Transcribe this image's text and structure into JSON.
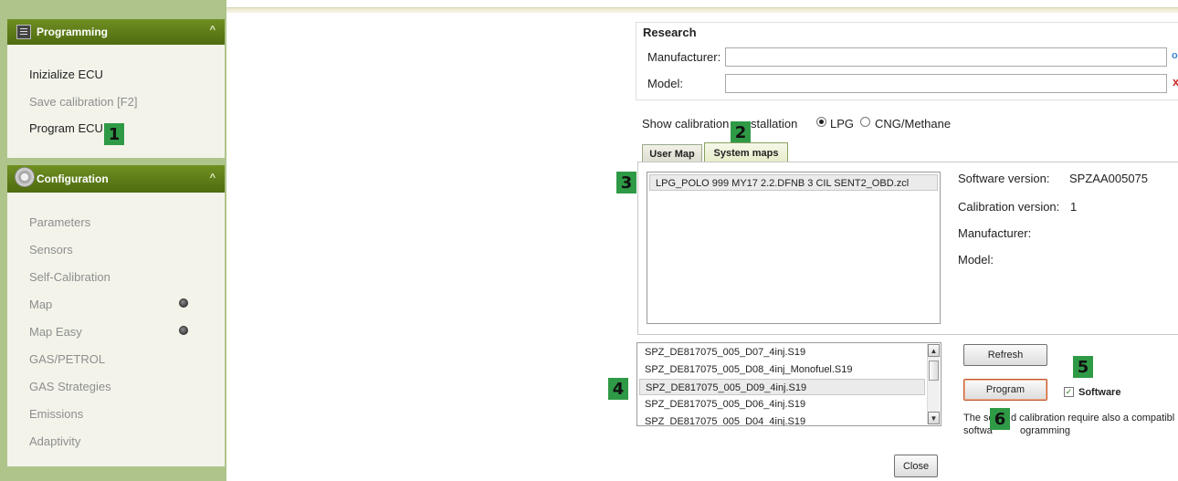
{
  "sidebar": {
    "programming": {
      "title": "Programming",
      "items": [
        {
          "label": "Inizialize ECU"
        },
        {
          "label": "Save calibration [F2]"
        },
        {
          "label": "Program ECU"
        }
      ]
    },
    "configuration": {
      "title": "Configuration",
      "items": [
        {
          "label": "Parameters"
        },
        {
          "label": "Sensors"
        },
        {
          "label": "Self-Calibration"
        },
        {
          "label": "Map"
        },
        {
          "label": "Map Easy"
        },
        {
          "label": "GAS/PETROL"
        },
        {
          "label": "GAS Strategies"
        },
        {
          "label": "Emissions"
        },
        {
          "label": "Adaptivity"
        }
      ]
    }
  },
  "research": {
    "title": "Research",
    "manufacturer_label": "Manufacturer:",
    "manufacturer_value": "",
    "model_label": "Model:",
    "model_value": ""
  },
  "calibration": {
    "show_label": "Show calibration",
    "installation_label": "stallation",
    "option_lpg": "LPG",
    "option_cng": "CNG/Methane",
    "selected": "LPG"
  },
  "tabs": [
    {
      "label": "User Map",
      "active": false
    },
    {
      "label": "System maps",
      "active": true
    }
  ],
  "system_maps": {
    "files": [
      "LPG_POLO 999 MY17 2.2.DFNB 3 CIL SENT2_OBD.zcl"
    ],
    "software_version_label": "Software version:",
    "software_version_value": "SPZAA005075",
    "calibration_version_label": "Calibration version:",
    "calibration_version_value": "1",
    "manufacturer_label": "Manufacturer:",
    "model_label": "Model:"
  },
  "software_files": [
    "SPZ_DE817075_005_D07_4inj.S19",
    "SPZ_DE817075_005_D08_4inj_Monofuel.S19",
    "SPZ_DE817075_005_D09_4inj.S19",
    "SPZ_DE817075_005_D06_4inj.S19",
    "SPZ_DE817075_005_D04_4inj.S19"
  ],
  "buttons": {
    "refresh": "Refresh",
    "program": "Program",
    "close": "Close"
  },
  "software_checkbox": {
    "label": "Software",
    "checked": true
  },
  "message": {
    "line1": "The se",
    "line1b": "d calibration require also a compatibl",
    "line2": "softwa",
    "line2b": "ogramming"
  },
  "badges": [
    "1",
    "2",
    "3",
    "4",
    "5",
    "6"
  ],
  "colors": {
    "sidebar_bg": "#aec48a",
    "header_green": "#5a7a18",
    "badge_green": "#2f9a46"
  }
}
